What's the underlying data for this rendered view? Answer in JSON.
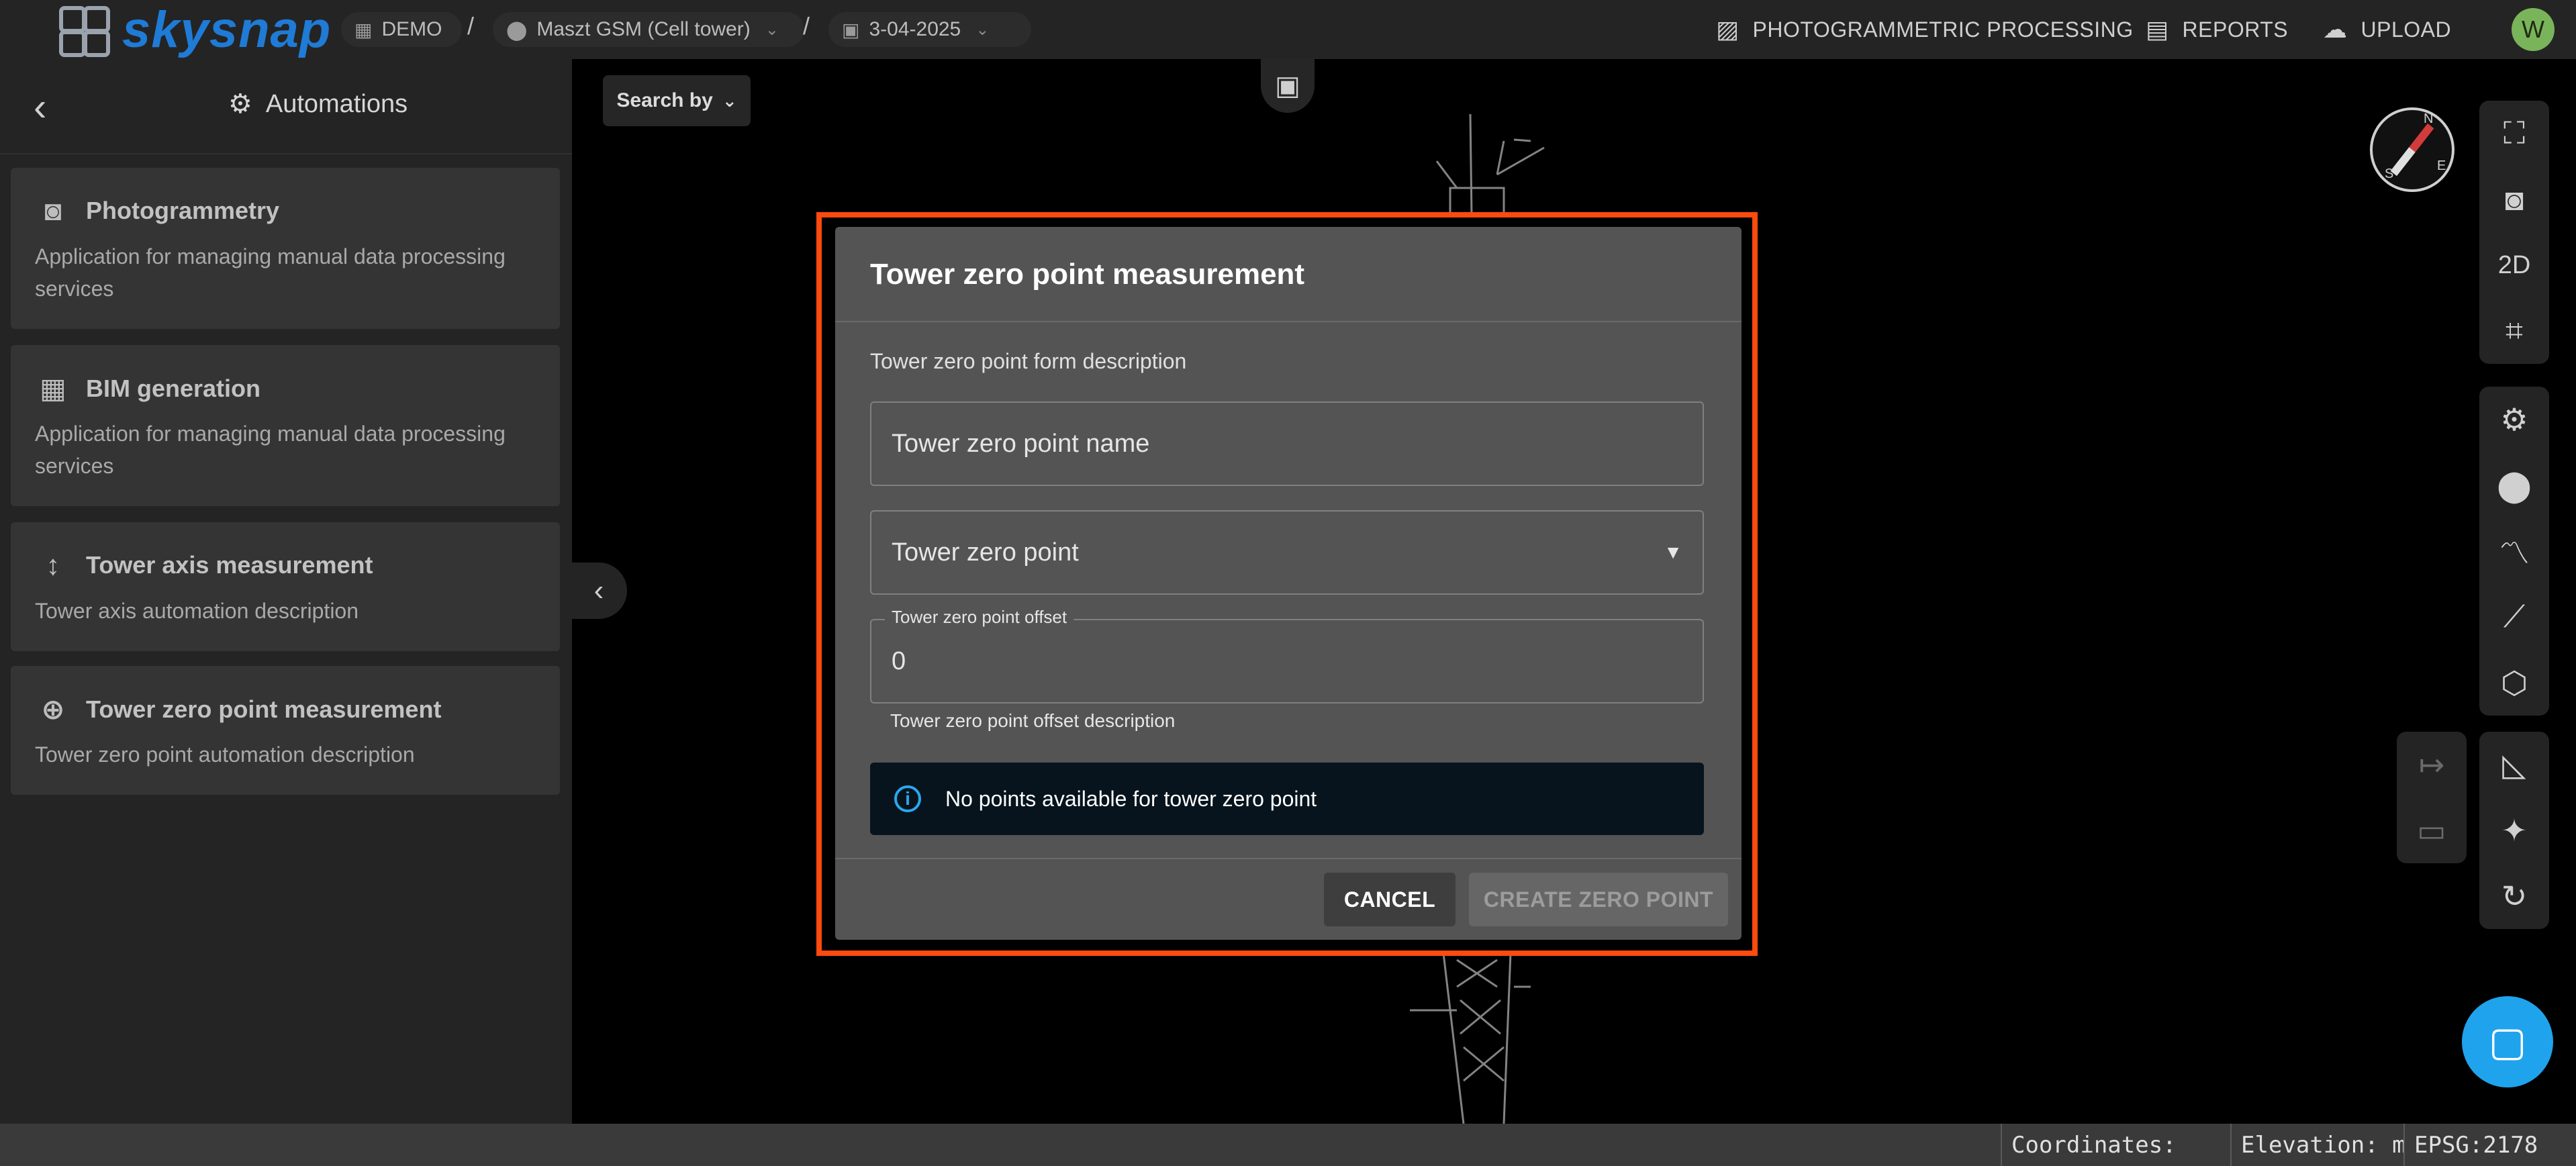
{
  "app": {
    "logo_text": "skysnap"
  },
  "breadcrumb": {
    "workspace": "DEMO",
    "site": "Maszt GSM (Cell tower)",
    "date": "3-04-2025",
    "separator": "/"
  },
  "top_nav": {
    "photogrammetric": "PHOTOGRAMMETRIC PROCESSING",
    "reports": "REPORTS",
    "upload": "UPLOAD",
    "avatar_initial": "W"
  },
  "sidebar": {
    "title": "Automations",
    "items": [
      {
        "title": "Photogrammetry",
        "description": "Application for managing manual data processing services",
        "icon": "camera-icon"
      },
      {
        "title": "BIM generation",
        "description": "Application for managing manual data processing services",
        "icon": "building-icon"
      },
      {
        "title": "Tower axis measurement",
        "description": "Tower axis automation description",
        "icon": "vertical-arrows-icon"
      },
      {
        "title": "Tower zero point measurement",
        "description": "Tower zero point automation description",
        "icon": "crosshair-icon"
      }
    ]
  },
  "viewer": {
    "search_by_label": "Search by"
  },
  "right_toolbar": {
    "view_2d_label": "2D"
  },
  "modal": {
    "title": "Tower zero point measurement",
    "description": "Tower zero point form description",
    "name_placeholder": "Tower zero point name",
    "point_select_label": "Tower zero point",
    "offset_label": "Tower zero point offset",
    "offset_value": "0",
    "offset_help": "Tower zero point offset description",
    "alert_text": "No points available for tower zero point",
    "cancel_label": "CANCEL",
    "create_label": "CREATE ZERO POINT"
  },
  "status_bar": {
    "coordinates": "Coordinates:",
    "elevation": "Elevation: m",
    "epsg": "EPSG:2178"
  },
  "colors": {
    "highlight": "#ff4a0f",
    "brand": "#1f7bd6",
    "info": "#29a8f0",
    "fab": "#1fa3ec"
  }
}
